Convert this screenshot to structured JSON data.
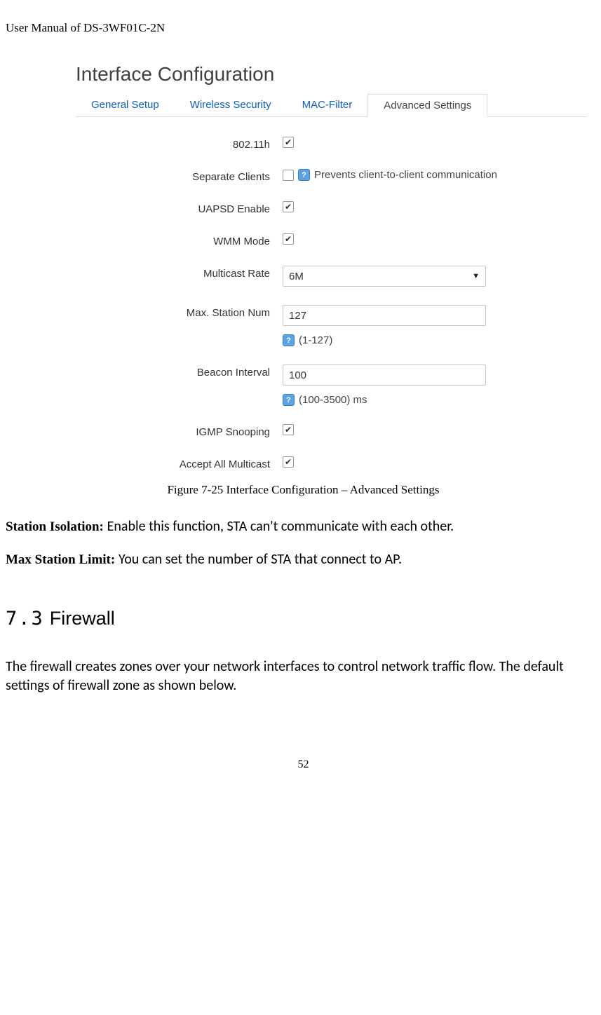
{
  "doc_header": "User Manual of DS-3WF01C-2N",
  "panel_title": "Interface Configuration",
  "tabs": {
    "general": "General Setup",
    "wireless": "Wireless Security",
    "mac": "MAC-Filter",
    "advanced": "Advanced Settings"
  },
  "fields": {
    "f80211h": {
      "label": "802.11h",
      "checked": "✔"
    },
    "separate": {
      "label": "Separate Clients",
      "checked": "",
      "hint": "Prevents client-to-client communication"
    },
    "uapsd": {
      "label": "UAPSD Enable",
      "checked": "✔"
    },
    "wmm": {
      "label": "WMM Mode",
      "checked": "✔"
    },
    "mcast": {
      "label": "Multicast Rate",
      "value": "6M"
    },
    "maxsta": {
      "label": "Max. Station Num",
      "value": "127",
      "hint": "(1-127)"
    },
    "beacon": {
      "label": "Beacon Interval",
      "value": "100",
      "hint": "(100-3500) ms"
    },
    "igmp": {
      "label": "IGMP Snooping",
      "checked": "✔"
    },
    "acceptmc": {
      "label": "Accept All Multicast",
      "checked": "✔"
    }
  },
  "help_badge": "?",
  "figure_caption": "Figure 7-25 Interface Configuration – Advanced Settings",
  "para_isolation": {
    "lead": "Station Isolation: ",
    "text": "Enable this function, STA can't communicate with each other."
  },
  "para_maxsta": {
    "lead": "Max Station Limit: ",
    "text": "You can set the number of STA that connect to AP."
  },
  "section": {
    "num": "7.3",
    "title": "Firewall"
  },
  "section_body": "The firewall creates zones over your network interfaces to control network traffic flow. The default settings of firewall zone as shown below.",
  "page_number": "52"
}
